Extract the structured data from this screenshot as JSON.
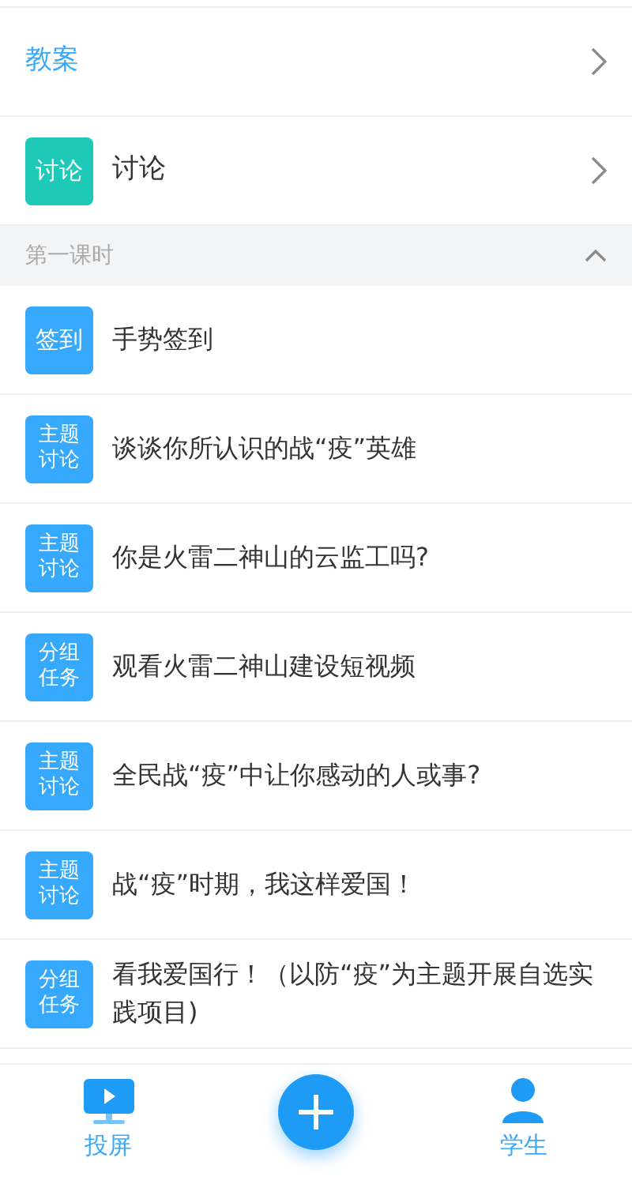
{
  "top_items": [
    {
      "kind": "link",
      "label": "教案"
    },
    {
      "kind": "badge",
      "badge": "讨论",
      "color": "#1ec9b7",
      "label": "讨论"
    }
  ],
  "section": {
    "title": "第一课时",
    "expanded": true
  },
  "activities": [
    {
      "badge": "签到",
      "label": "手势签到"
    },
    {
      "badge": "主题讨论",
      "label": "谈谈你所认识的战“疫”英雄"
    },
    {
      "badge": "主题讨论",
      "label": "你是火雷二神山的云监工吗?"
    },
    {
      "badge": "分组任务",
      "label": "观看火雷二神山建设短视频"
    },
    {
      "badge": "主题讨论",
      "label": "全民战“疫”中让你感动的人或事?"
    },
    {
      "badge": "主题讨论",
      "label": "战“疫”时期，我这样爱国！"
    },
    {
      "badge": "分组任务",
      "label": "看我爱国行！（以防“疫”为主题开展自选实践项目)"
    }
  ],
  "bottom_nav": [
    {
      "kind": "screen",
      "label": "投屏"
    },
    {
      "kind": "add"
    },
    {
      "kind": "user",
      "label": "学生"
    }
  ]
}
